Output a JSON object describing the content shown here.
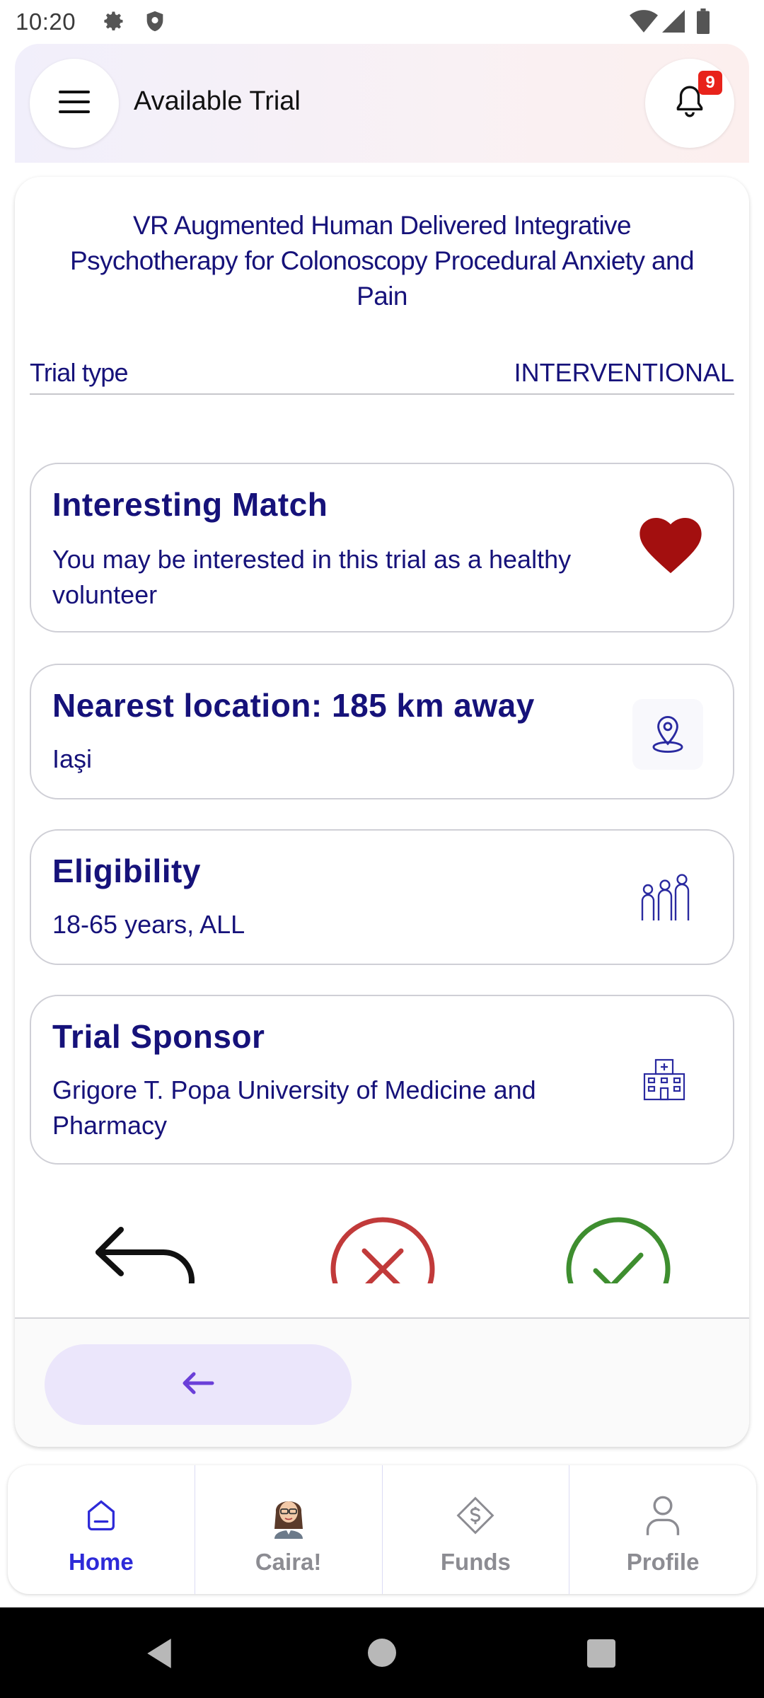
{
  "status_bar": {
    "time": "10:20",
    "icons": [
      "gear-icon",
      "shield-icon",
      "wifi-icon",
      "signal-icon",
      "battery-icon"
    ]
  },
  "header": {
    "title": "Available Trial",
    "menu_icon": "hamburger-menu-icon",
    "bell_icon": "bell-icon",
    "notification_count": "9"
  },
  "trial": {
    "title": "VR Augmented Human Delivered Integrative Psychotherapy for Colonoscopy Procedural Anxiety and Pain",
    "type_label": "Trial type",
    "type_value": "INTERVENTIONAL"
  },
  "cards": {
    "match": {
      "title": "Interesting Match",
      "text": "You may be interested in this trial as a healthy volunteer",
      "icon": "heart-icon"
    },
    "location": {
      "title": "Nearest location: 185 km away",
      "text": "Iaşi",
      "icon": "location-pin-icon"
    },
    "eligibility": {
      "title": "Eligibility",
      "text": "18-65 years, ALL",
      "icon": "people-group-icon"
    },
    "sponsor": {
      "title": "Trial Sponsor",
      "text": "Grigore T. Popa University of Medicine and Pharmacy",
      "icon": "hospital-icon"
    }
  },
  "actions": {
    "undo_icon": "undo-arrow-icon",
    "reject_icon": "reject-x-icon",
    "accept_icon": "accept-check-icon",
    "back_icon": "arrow-left-icon"
  },
  "bottom_nav": {
    "items": [
      {
        "label": "Home",
        "icon": "home-icon",
        "active": true
      },
      {
        "label": "Caira!",
        "icon": "avatar-icon",
        "active": false
      },
      {
        "label": "Funds",
        "icon": "funds-icon",
        "active": false
      },
      {
        "label": "Profile",
        "icon": "profile-icon",
        "active": false
      }
    ]
  },
  "colors": {
    "primary_text": "#16127a",
    "accent": "#2d2ad8",
    "heart": "#a30f0f",
    "reject": "#c13a3a",
    "accept": "#3e8e2f",
    "back_pill": "#ebe6fb"
  }
}
